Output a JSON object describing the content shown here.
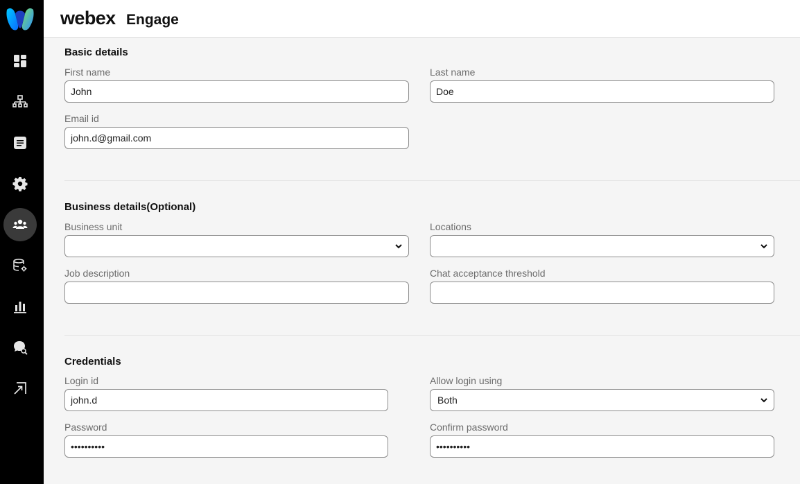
{
  "app": {
    "brand": "webex",
    "product": "Engage"
  },
  "rail": {
    "items": [
      {
        "icon": "dashboard-icon"
      },
      {
        "icon": "org-chart-icon"
      },
      {
        "icon": "document-icon"
      },
      {
        "icon": "gear-icon"
      },
      {
        "icon": "users-icon",
        "active": true
      },
      {
        "icon": "database-settings-icon"
      },
      {
        "icon": "bar-chart-icon"
      },
      {
        "icon": "chat-search-icon"
      },
      {
        "icon": "logout-icon"
      }
    ]
  },
  "basic": {
    "title": "Basic details",
    "first_name_label": "First name",
    "first_name_value": "John",
    "last_name_label": "Last name",
    "last_name_value": "Doe",
    "email_label": "Email id",
    "email_value": "john.d@gmail.com"
  },
  "business": {
    "title": "Business details(Optional)",
    "unit_label": "Business unit",
    "unit_value": "",
    "locations_label": "Locations",
    "locations_value": "",
    "job_label": "Job description",
    "job_value": "",
    "threshold_label": "Chat acceptance threshold",
    "threshold_value": ""
  },
  "credentials": {
    "title": "Credentials",
    "login_label": "Login id",
    "login_value": "john.d",
    "allow_label": "Allow login using",
    "allow_value": "Both",
    "password_label": "Password",
    "password_value": "••••••••••",
    "confirm_label": "Confirm password",
    "confirm_value": "••••••••••"
  },
  "colors": {
    "rail_bg": "#000000",
    "rail_active": "#3a3a3a",
    "page_bg": "#f5f5f5"
  }
}
